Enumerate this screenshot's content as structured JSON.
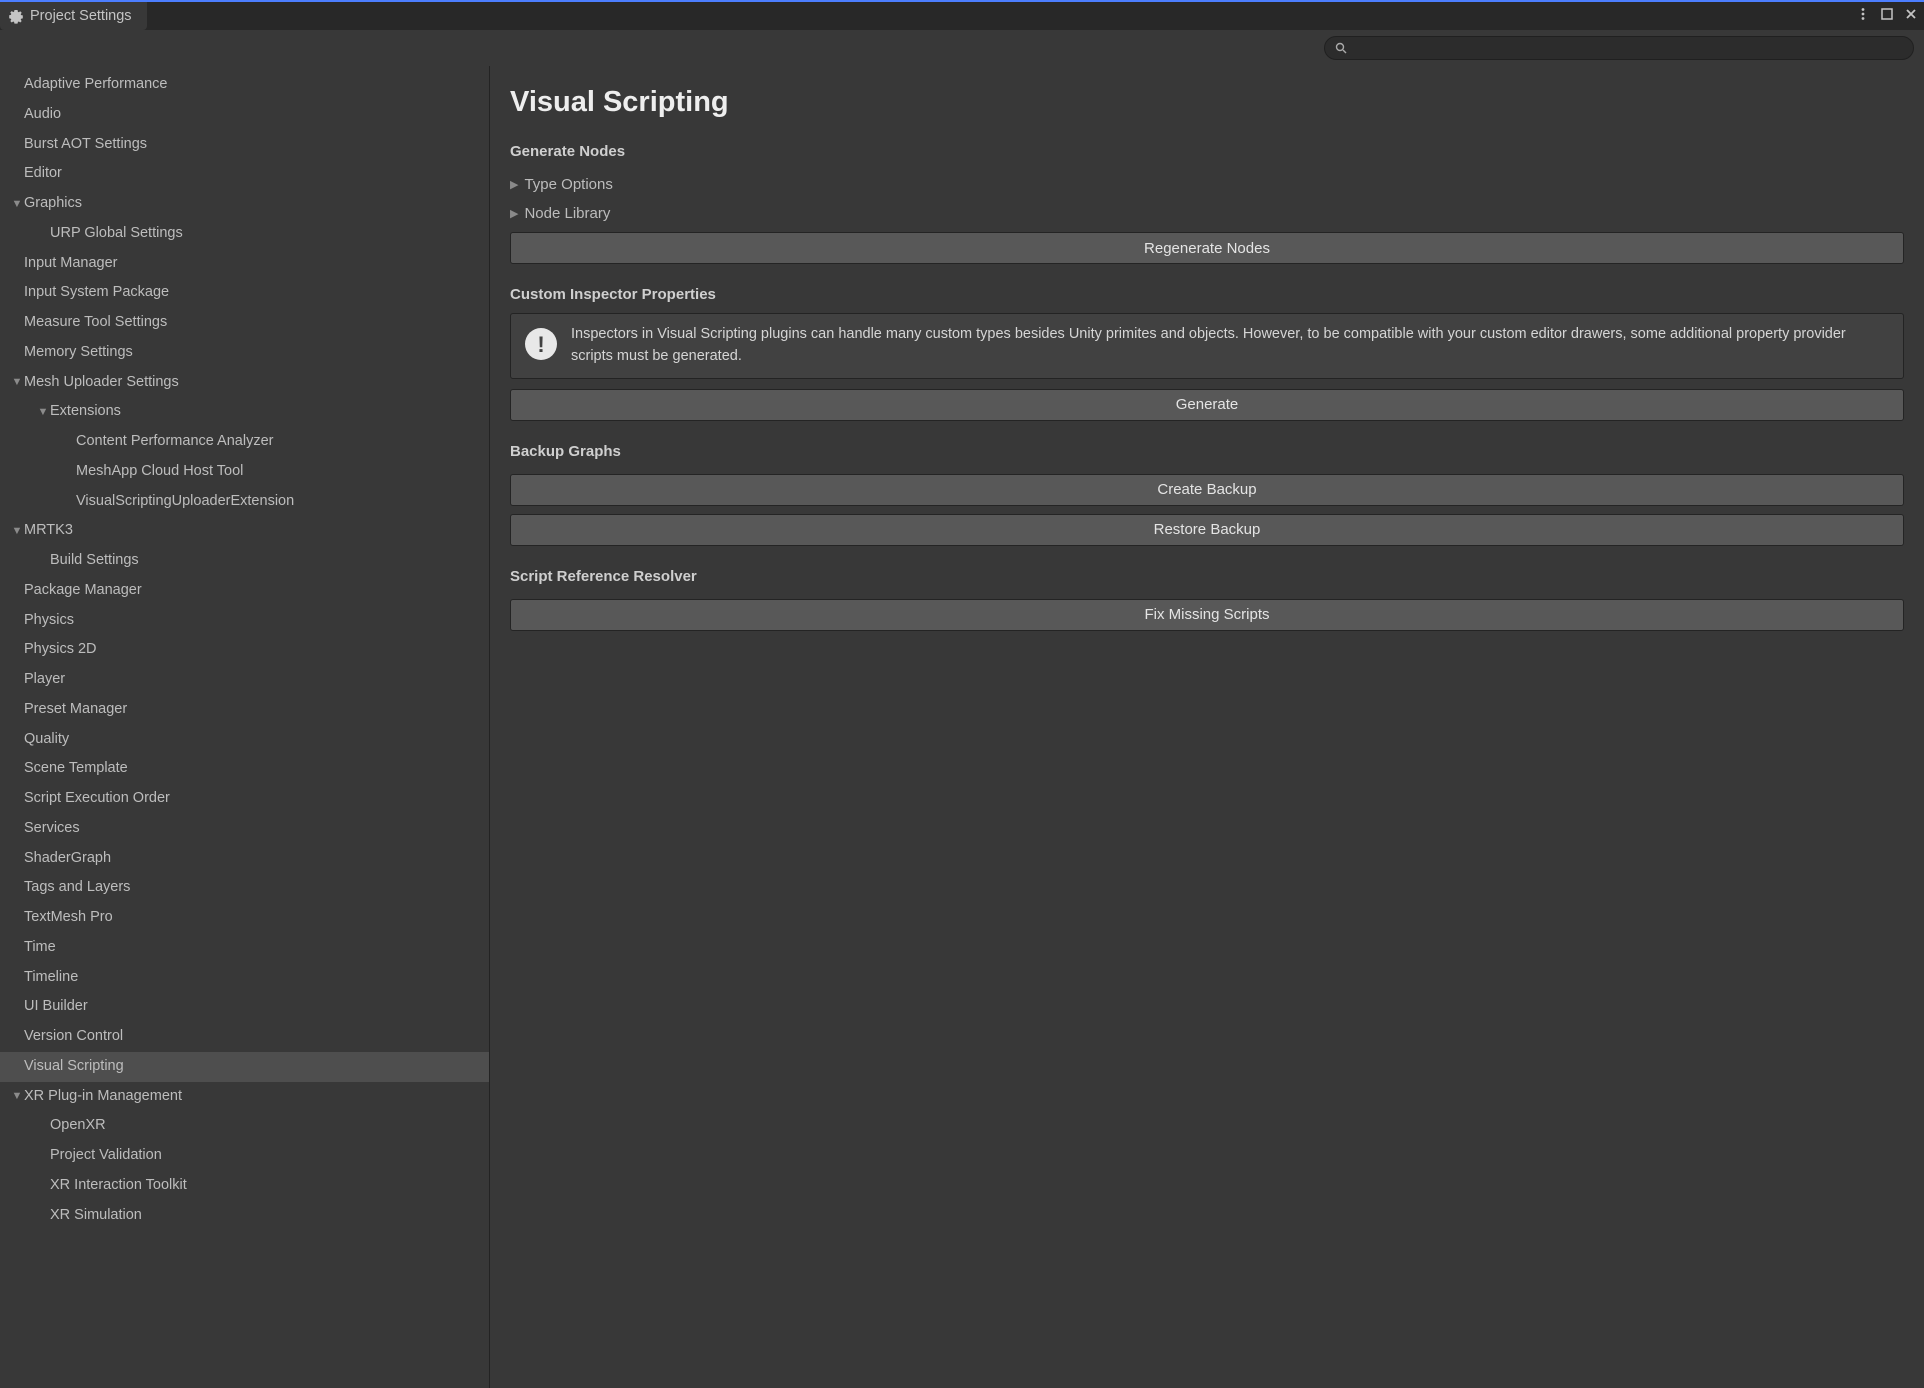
{
  "tab": {
    "title": "Project Settings"
  },
  "search": {
    "value": ""
  },
  "sidebar": {
    "items": [
      {
        "label": "Adaptive Performance",
        "depth": 1,
        "arrow": ""
      },
      {
        "label": "Audio",
        "depth": 1,
        "arrow": ""
      },
      {
        "label": "Burst AOT Settings",
        "depth": 1,
        "arrow": ""
      },
      {
        "label": "Editor",
        "depth": 1,
        "arrow": ""
      },
      {
        "label": "Graphics",
        "depth": 1,
        "arrow": "▼"
      },
      {
        "label": "URP Global Settings",
        "depth": 2,
        "arrow": ""
      },
      {
        "label": "Input Manager",
        "depth": 1,
        "arrow": ""
      },
      {
        "label": "Input System Package",
        "depth": 1,
        "arrow": ""
      },
      {
        "label": "Measure Tool Settings",
        "depth": 1,
        "arrow": ""
      },
      {
        "label": "Memory Settings",
        "depth": 1,
        "arrow": ""
      },
      {
        "label": "Mesh Uploader Settings",
        "depth": 1,
        "arrow": "▼"
      },
      {
        "label": "Extensions",
        "depth": 2,
        "arrow": "▼"
      },
      {
        "label": "Content Performance Analyzer",
        "depth": 3,
        "arrow": ""
      },
      {
        "label": "MeshApp Cloud Host Tool",
        "depth": 3,
        "arrow": ""
      },
      {
        "label": "VisualScriptingUploaderExtension",
        "depth": 3,
        "arrow": ""
      },
      {
        "label": "MRTK3",
        "depth": 1,
        "arrow": "▼"
      },
      {
        "label": "Build Settings",
        "depth": 2,
        "arrow": ""
      },
      {
        "label": "Package Manager",
        "depth": 1,
        "arrow": ""
      },
      {
        "label": "Physics",
        "depth": 1,
        "arrow": ""
      },
      {
        "label": "Physics 2D",
        "depth": 1,
        "arrow": ""
      },
      {
        "label": "Player",
        "depth": 1,
        "arrow": ""
      },
      {
        "label": "Preset Manager",
        "depth": 1,
        "arrow": ""
      },
      {
        "label": "Quality",
        "depth": 1,
        "arrow": ""
      },
      {
        "label": "Scene Template",
        "depth": 1,
        "arrow": ""
      },
      {
        "label": "Script Execution Order",
        "depth": 1,
        "arrow": ""
      },
      {
        "label": "Services",
        "depth": 1,
        "arrow": ""
      },
      {
        "label": "ShaderGraph",
        "depth": 1,
        "arrow": ""
      },
      {
        "label": "Tags and Layers",
        "depth": 1,
        "arrow": ""
      },
      {
        "label": "TextMesh Pro",
        "depth": 1,
        "arrow": ""
      },
      {
        "label": "Time",
        "depth": 1,
        "arrow": ""
      },
      {
        "label": "Timeline",
        "depth": 1,
        "arrow": ""
      },
      {
        "label": "UI Builder",
        "depth": 1,
        "arrow": ""
      },
      {
        "label": "Version Control",
        "depth": 1,
        "arrow": ""
      },
      {
        "label": "Visual Scripting",
        "depth": 1,
        "arrow": "",
        "selected": true
      },
      {
        "label": "XR Plug-in Management",
        "depth": 1,
        "arrow": "▼"
      },
      {
        "label": "OpenXR",
        "depth": 2,
        "arrow": ""
      },
      {
        "label": "Project Validation",
        "depth": 2,
        "arrow": ""
      },
      {
        "label": "XR Interaction Toolkit",
        "depth": 2,
        "arrow": ""
      },
      {
        "label": "XR Simulation",
        "depth": 2,
        "arrow": ""
      }
    ]
  },
  "content": {
    "title": "Visual Scripting",
    "section_generate": "Generate Nodes",
    "foldout_type_options": "Type Options",
    "foldout_node_library": "Node Library",
    "btn_regenerate": "Regenerate Nodes",
    "section_custom_inspector": "Custom Inspector Properties",
    "info_text": "Inspectors in Visual Scripting plugins can handle many custom types besides Unity primites and objects. However, to be compatible with your custom editor drawers, some additional property provider scripts must be generated.",
    "btn_generate": "Generate",
    "section_backup": "Backup Graphs",
    "btn_create_backup": "Create Backup",
    "btn_restore_backup": "Restore Backup",
    "section_script_ref": "Script Reference Resolver",
    "btn_fix_missing": "Fix Missing Scripts"
  }
}
